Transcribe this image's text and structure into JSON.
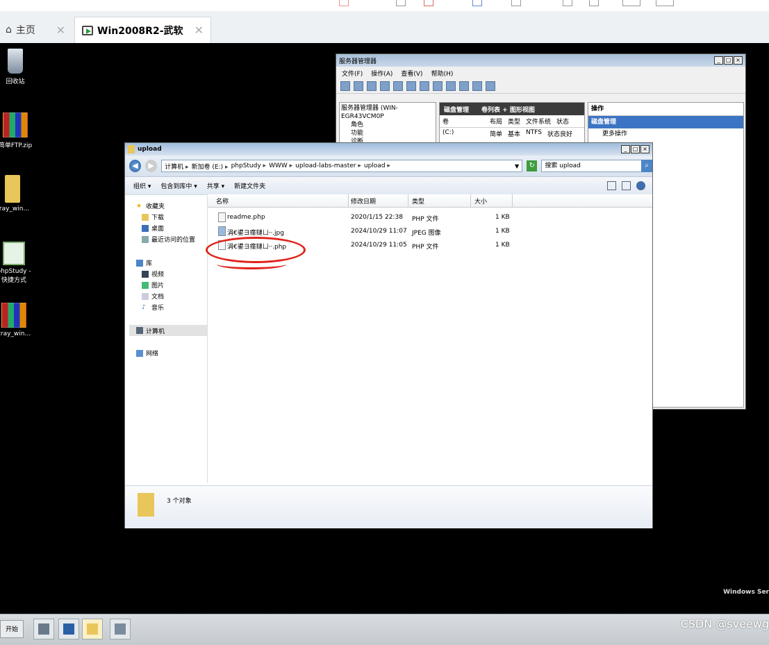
{
  "host": {
    "tabs": [
      {
        "label": "主页",
        "icon": "home-icon"
      },
      {
        "label": "Win2008R2-武软",
        "icon": "vm-icon"
      }
    ]
  },
  "desktop": {
    "icons": [
      {
        "label": "回收站",
        "icon": "recycle-bin-icon"
      },
      {
        "label": "简单FTP.zip",
        "icon": "rar-archive-icon"
      },
      {
        "label": "cray_win...",
        "icon": "folder-icon"
      },
      {
        "label": "phpStudy - 快捷方式",
        "icon": "phpstudy-icon"
      },
      {
        "label": "cray_win...",
        "icon": "rar-archive-icon"
      }
    ],
    "branding": "Windows Ser"
  },
  "server_manager": {
    "title": "服务器管理器",
    "menu": [
      "文件(F)",
      "操作(A)",
      "查看(V)",
      "帮助(H)"
    ],
    "tree": [
      "服务器管理器 (WIN-EGR43VCM0P",
      "角色",
      "功能",
      "诊断"
    ],
    "panel_header": [
      "磁盘管理",
      "卷列表 + 图形视图"
    ],
    "columns": [
      "卷",
      "布局",
      "类型",
      "文件系统",
      "状态"
    ],
    "row": [
      "(C:)",
      "简单",
      "基本",
      "NTFS",
      "状态良好"
    ],
    "actions_title": "操作",
    "actions_section": "磁盘管理",
    "actions_item": "更多操作"
  },
  "explorer": {
    "title": "upload",
    "breadcrumb": [
      "计算机",
      "新加卷 (E:)",
      "phpStudy",
      "WWW",
      "upload-labs-master",
      "upload"
    ],
    "search_placeholder": "搜索 upload",
    "commands": [
      "组织 ▾",
      "包含到库中 ▾",
      "共享 ▾",
      "新建文件夹"
    ],
    "nav": [
      {
        "label": "收藏夹",
        "icon": "star-icon"
      },
      {
        "label": "下载",
        "icon": "download-icon"
      },
      {
        "label": "桌面",
        "icon": "desktop-icon"
      },
      {
        "label": "最近访问的位置",
        "icon": "recent-icon"
      },
      {
        "label": "库",
        "icon": "library-icon"
      },
      {
        "label": "视频",
        "icon": "video-icon"
      },
      {
        "label": "图片",
        "icon": "picture-icon"
      },
      {
        "label": "文档",
        "icon": "document-icon"
      },
      {
        "label": "音乐",
        "icon": "music-icon"
      },
      {
        "label": "计算机",
        "icon": "computer-icon"
      },
      {
        "label": "网络",
        "icon": "network-icon"
      }
    ],
    "columns": [
      "名称",
      "修改日期",
      "类型",
      "大小"
    ],
    "files": [
      {
        "name": "readme.php",
        "date": "2020/1/15 22:38",
        "type": "PHP 文件",
        "size": "1 KB"
      },
      {
        "name": "涓€鍙ヨ瘽鏈ㄩ┈.jpg",
        "date": "2024/10/29 11:07",
        "type": "JPEG 图像",
        "size": "1 KB"
      },
      {
        "name": "涓€鍙ヨ瘽鏈ㄩ┈.php",
        "date": "2024/10/29 11:05",
        "type": "PHP 文件",
        "size": "1 KB"
      }
    ],
    "status": "3 个对象"
  },
  "taskbar": {
    "start_label": "开始",
    "watermark": "CSDN @sveewg"
  },
  "colors": {
    "annotation": "#e0241a",
    "desktop": "#000000"
  }
}
